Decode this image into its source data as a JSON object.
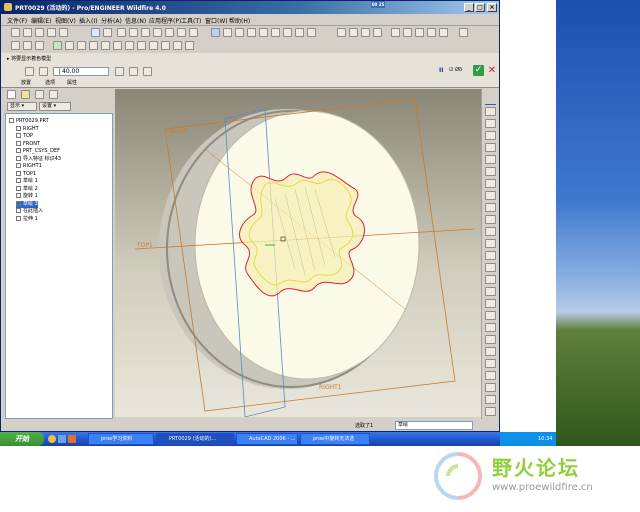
{
  "window": {
    "title": "PRT0029 (活动的) - Pro/ENGINEER Wildfire 4.0",
    "mini_caption": "00 25"
  },
  "menubar": [
    "文件(F)",
    "编辑(E)",
    "视图(V)",
    "插入(I)",
    "分析(A)",
    "信息(N)",
    "应用程序(P)",
    "工具(T)",
    "窗口(W)",
    "帮助(H)"
  ],
  "dashboard": {
    "prompt": "▸ 将要显示着色模型",
    "depth_value": "40.00",
    "tabs": [
      "放置",
      "选项",
      "属性"
    ],
    "pause_label": "II",
    "preview_label": "☑ Øδ"
  },
  "navigator": {
    "show_label": "显示 ▾",
    "settings_label": "设置 ▾",
    "items": [
      {
        "label": "PRT0029.PRT",
        "indent": 0
      },
      {
        "label": "RIGHT",
        "indent": 1
      },
      {
        "label": "TOP",
        "indent": 1
      },
      {
        "label": "FRONT",
        "indent": 1
      },
      {
        "label": "PRT_CSYS_DEF",
        "indent": 1
      },
      {
        "label": "导入特征 标识43",
        "indent": 1
      },
      {
        "label": "RIGHT1",
        "indent": 1
      },
      {
        "label": "TOP1",
        "indent": 1
      },
      {
        "label": "草绘 1",
        "indent": 1
      },
      {
        "label": "草绘 2",
        "indent": 1
      },
      {
        "label": "旋转 1",
        "indent": 1
      },
      {
        "label": "草绘 3",
        "indent": 1,
        "selected": true
      },
      {
        "label": "在此插入",
        "indent": 1
      },
      {
        "label": "拉伸 1",
        "indent": 1
      }
    ]
  },
  "viewport": {
    "plane_labels": [
      "FRONT",
      "TOP1",
      "RIGHT1"
    ]
  },
  "statusbar": {
    "selected_text": "选取了1",
    "filter_value": "草绘"
  },
  "taskbar": {
    "start": "开始",
    "tasks": [
      {
        "label": "proe学习资料",
        "active": false
      },
      {
        "label": "PRT0029 (活动的)...",
        "active": true
      },
      {
        "label": "AutoCAD 2006 - ...",
        "active": false
      },
      {
        "label": "proe中旋转无法选",
        "active": false
      }
    ],
    "clock": "10:34"
  },
  "watermark": {
    "name": "野火论坛",
    "url": "www.proewildfire.cn"
  },
  "colors": {
    "titlebar": "#0a246a",
    "sketch_red": "#d4243c",
    "sketch_yellow": "#e6d84a",
    "plane_orange": "#c87a2a",
    "plane_blue": "#5a8ac8"
  }
}
